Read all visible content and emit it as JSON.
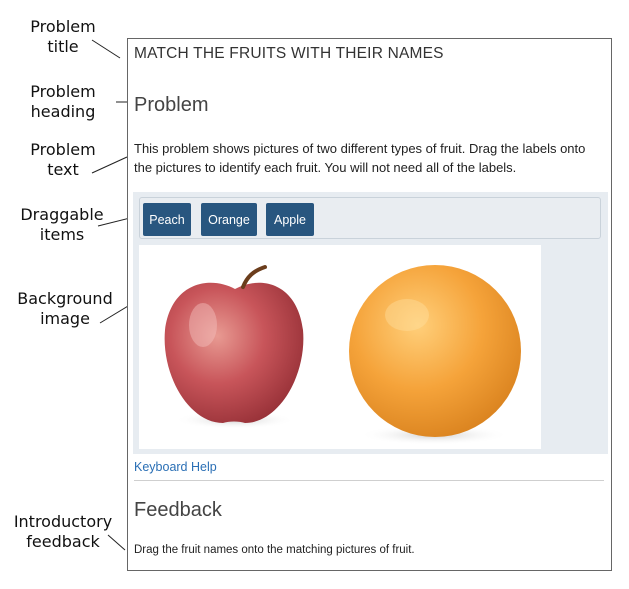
{
  "callouts": {
    "problem_title": "Problem\ntitle",
    "problem_heading": "Problem\nheading",
    "problem_text": "Problem\ntext",
    "draggable_items": "Draggable\nitems",
    "background_image": "Background\nimage",
    "introductory_feedback": "Introductory\nfeedback"
  },
  "problem": {
    "title": "MATCH THE FRUITS WITH THEIR NAMES",
    "heading": "Problem",
    "text": "This problem shows pictures of two different types of fruit. Drag the labels onto the pictures to identify each fruit. You will not need all of the labels."
  },
  "draggables": [
    {
      "label": "Peach"
    },
    {
      "label": "Orange"
    },
    {
      "label": "Apple"
    }
  ],
  "keyboard_help": "Keyboard Help",
  "feedback": {
    "heading": "Feedback",
    "text": "Drag the fruit names onto the matching pictures of fruit."
  },
  "colors": {
    "draggable_bg": "#28567f",
    "link": "#2a6fb5",
    "dnd_area_bg": "#e7ecf1"
  },
  "icons": {
    "apple": "apple-icon",
    "orange": "orange-icon"
  }
}
